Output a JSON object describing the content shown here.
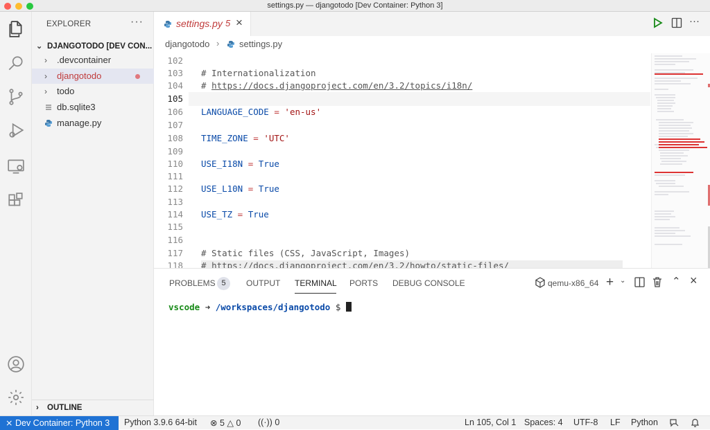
{
  "window": {
    "title": "settings.py — djangotodo [Dev Container: Python 3]"
  },
  "colors": {
    "accent": "#1f72d4",
    "error": "#c03b3b",
    "selection": "#e4e6f1",
    "modified_dot": "#e0787e"
  },
  "activitybar": {
    "icons": [
      "files-icon",
      "search-icon",
      "source-control-icon",
      "run-debug-icon",
      "remote-explorer-icon",
      "extensions-icon",
      "account-icon",
      "gear-icon"
    ]
  },
  "sidebar": {
    "header": "EXPLORER",
    "more": "···",
    "root": "DJANGOTODO [DEV CON...",
    "items": [
      {
        "label": ".devcontainer"
      },
      {
        "label": "djangotodo"
      },
      {
        "label": "todo"
      },
      {
        "label": "db.sqlite3"
      },
      {
        "label": "manage.py"
      }
    ],
    "outline": "OUTLINE"
  },
  "tabs": [
    {
      "label": "settings.py",
      "problems": "5"
    }
  ],
  "breadcrumb": {
    "folder": "djangotodo",
    "file": "settings.py"
  },
  "editor": {
    "current_line": "105",
    "lines": [
      {
        "num": "102",
        "text": ""
      },
      {
        "num": "103",
        "text": "# Internationalization"
      },
      {
        "num": "104",
        "text": "# ",
        "url": "https://docs.djangoproject.com/en/3.2/topics/i18n/"
      },
      {
        "num": "105",
        "text": ""
      },
      {
        "num": "106",
        "var": "LANGUAGE_CODE",
        "op": " = ",
        "val": "'en-us'"
      },
      {
        "num": "107",
        "text": ""
      },
      {
        "num": "108",
        "var": "TIME_ZONE",
        "op": " = ",
        "val": "'UTC'"
      },
      {
        "num": "109",
        "text": ""
      },
      {
        "num": "110",
        "var": "USE_I18N",
        "op": " = ",
        "val": "True"
      },
      {
        "num": "111",
        "text": ""
      },
      {
        "num": "112",
        "var": "USE_L10N",
        "op": " = ",
        "val": "True"
      },
      {
        "num": "113",
        "text": ""
      },
      {
        "num": "114",
        "var": "USE_TZ",
        "op": " = ",
        "val": "True"
      },
      {
        "num": "115",
        "text": ""
      },
      {
        "num": "116",
        "text": ""
      },
      {
        "num": "117",
        "text": "# Static files (CSS, JavaScript, Images)"
      },
      {
        "num": "118",
        "text": "# ",
        "url": "https://docs.djangoproject.com/en/3.2/howto/static-files/"
      }
    ]
  },
  "panel": {
    "tabs": [
      "PROBLEMS",
      "OUTPUT",
      "TERMINAL",
      "PORTS",
      "DEBUG CONSOLE"
    ],
    "problems_count": "5",
    "active_tab": "TERMINAL",
    "terminal_name": "qemu-x86_64",
    "prompt_user": "vscode",
    "prompt_arrow": "➜",
    "prompt_path": "/workspaces/djangotodo",
    "prompt_symbol": "$"
  },
  "statusbar": {
    "remote": "Dev Container: Python 3",
    "interpreter": "Python 3.9.6 64-bit",
    "errors": "5",
    "warnings": "0",
    "ports": "0",
    "position": "Ln 105, Col 1",
    "spaces": "Spaces: 4",
    "encoding": "UTF-8",
    "eol": "LF",
    "language": "Python"
  }
}
